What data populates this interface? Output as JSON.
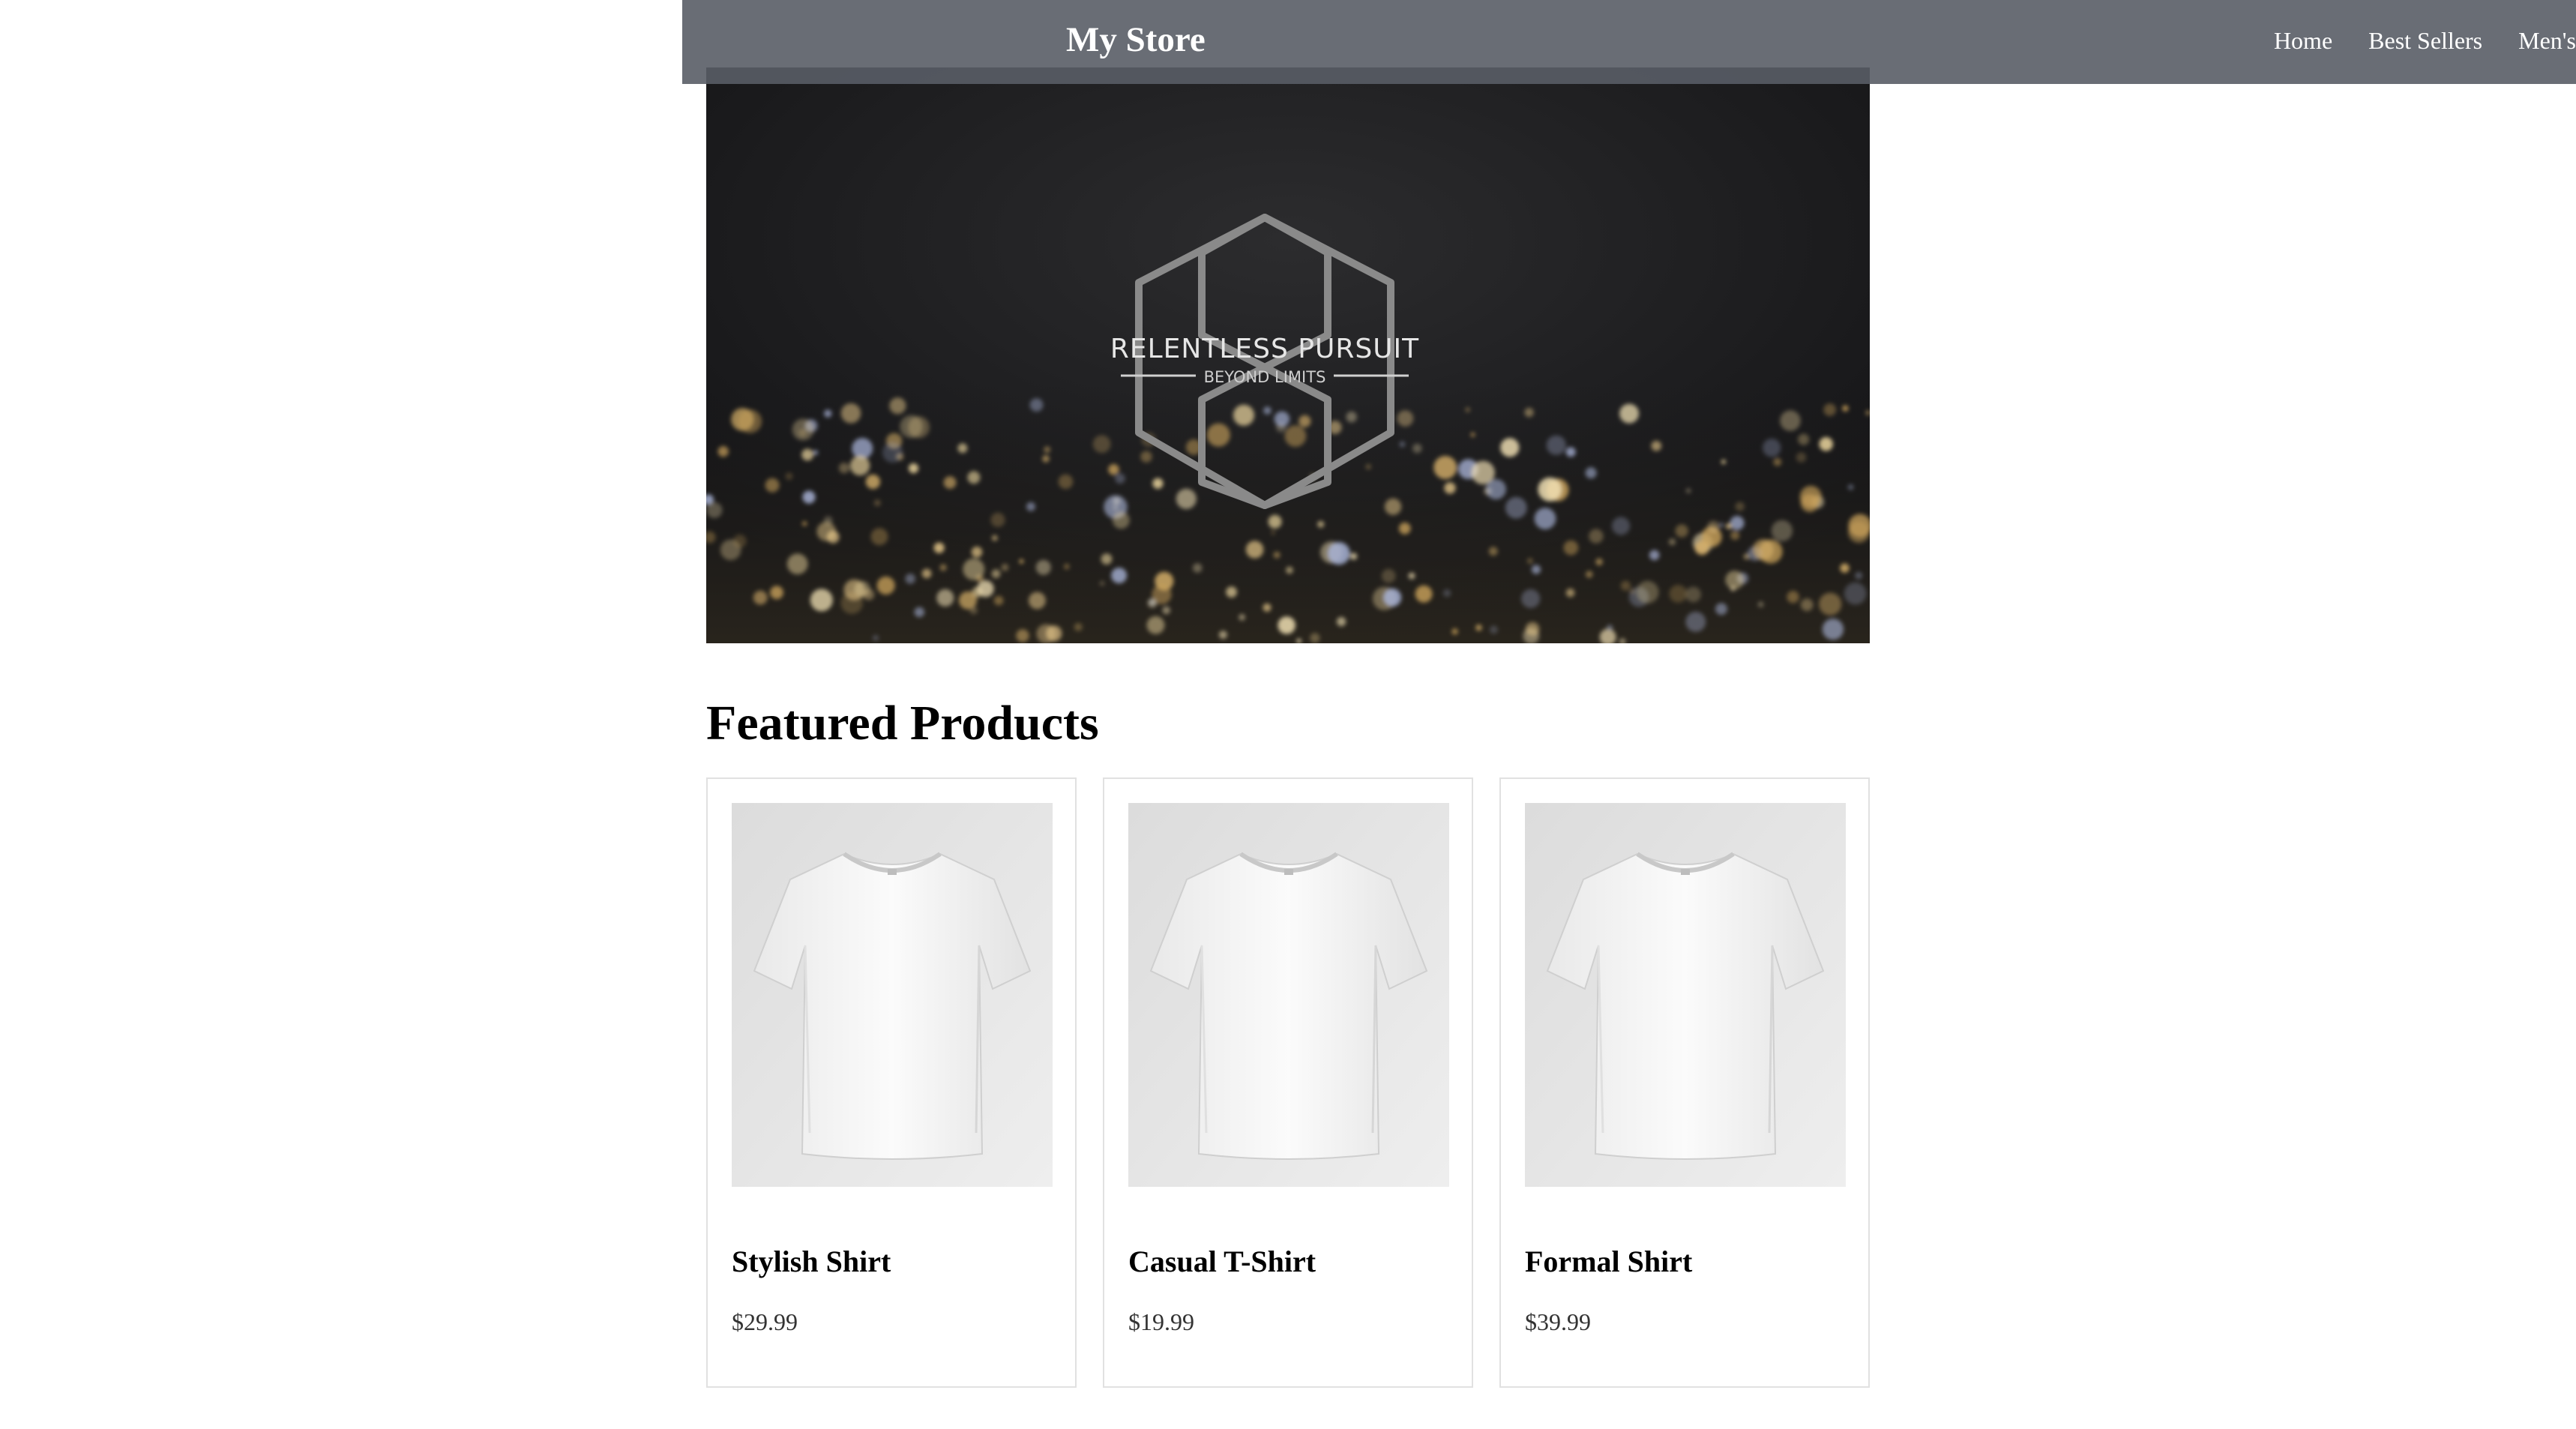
{
  "header": {
    "title": "My Store",
    "nav": [
      "Home",
      "Best Sellers",
      "Men's"
    ]
  },
  "hero": {
    "image_icon": "city-lights-banner",
    "logo": {
      "icon": "hexagon-logo-icon",
      "title": "RELENTLESS PURSUIT",
      "tagline": "BEYOND LIMITS"
    }
  },
  "featured": {
    "heading": "Featured Products",
    "products": [
      {
        "name": "Stylish Shirt",
        "price": "$29.99",
        "image_icon": "white-tshirt-photo"
      },
      {
        "name": "Casual T-Shirt",
        "price": "$19.99",
        "image_icon": "white-tshirt-photo"
      },
      {
        "name": "Formal Shirt",
        "price": "$39.99",
        "image_icon": "white-tshirt-photo"
      }
    ]
  },
  "colors": {
    "header_bg": "#595d66",
    "text": "#000000",
    "price_text": "#333333",
    "card_border": "#e1e1e1"
  }
}
